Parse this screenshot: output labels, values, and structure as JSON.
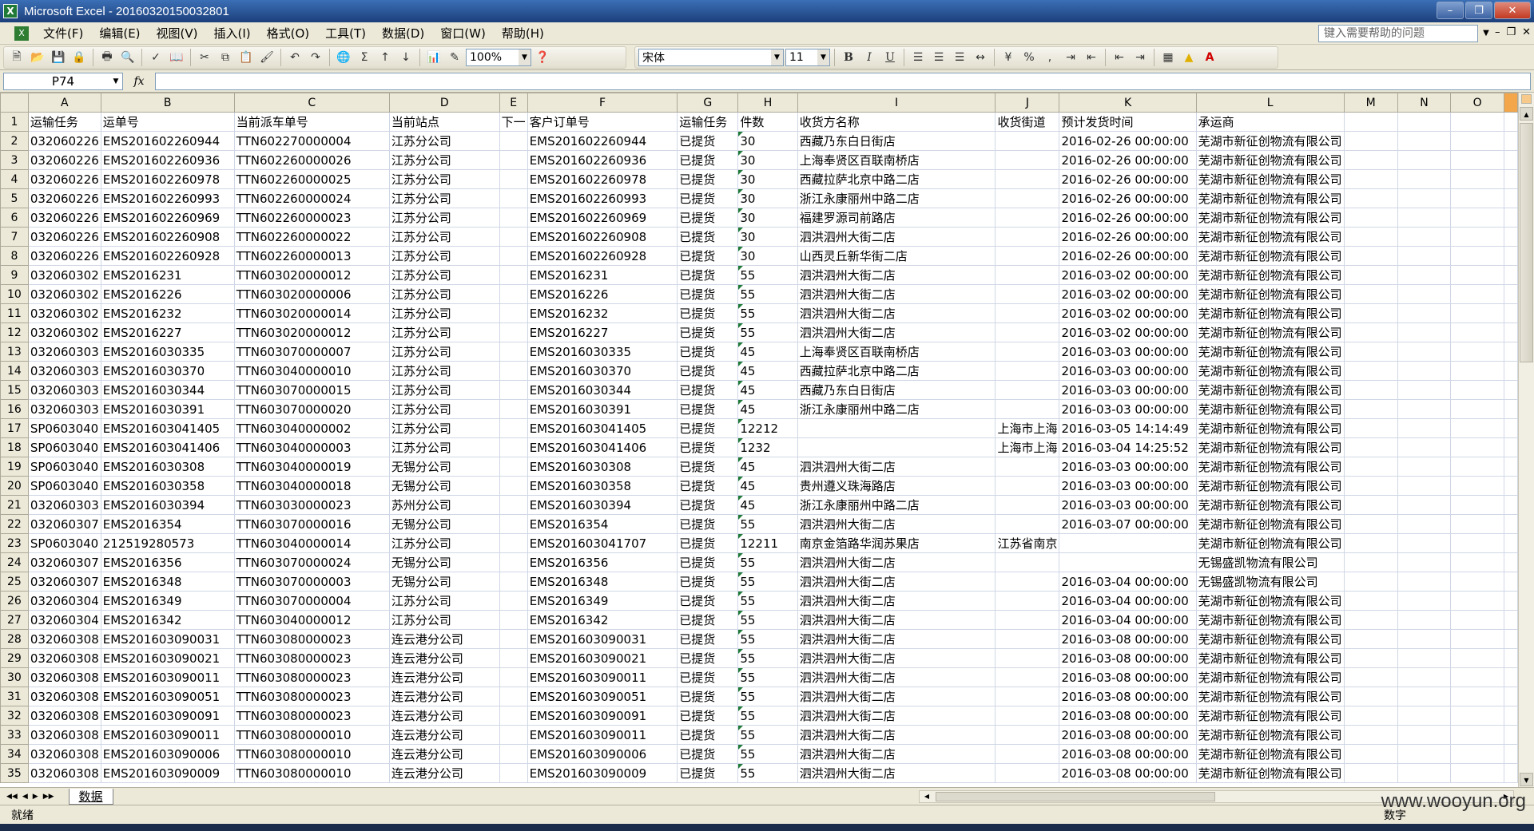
{
  "title": "Microsoft Excel - 20160320150032801",
  "menu": [
    "文件(F)",
    "编辑(E)",
    "视图(V)",
    "插入(I)",
    "格式(O)",
    "工具(T)",
    "数据(D)",
    "窗口(W)",
    "帮助(H)"
  ],
  "help_placeholder": "键入需要帮助的问题",
  "toolbar": {
    "zoom": "100%",
    "font_name": "宋体",
    "font_size": "11",
    "bold": "B",
    "italic": "I",
    "underline": "U",
    "percent": "%"
  },
  "name_box": "P74",
  "fx_label": "fx",
  "columns": [
    "A",
    "B",
    "C",
    "D",
    "E",
    "F",
    "G",
    "H",
    "I",
    "J",
    "K",
    "L",
    "M",
    "N",
    "O"
  ],
  "headers": [
    "运输任务",
    "运单号",
    "当前派车单号",
    "当前站点",
    "下一",
    "客户订单号",
    "运输任务",
    "件数",
    "收货方名称",
    "收货街道",
    "预计发货时间",
    "承运商",
    "",
    "",
    ""
  ],
  "rows": [
    [
      "032060226",
      "EMS201602260944",
      "TTN602270000004",
      "江苏分公司",
      "",
      "EMS201602260944",
      "已提货",
      "30",
      "西藏乃东白日街店",
      "",
      "2016-02-26 00:00:00",
      "芜湖市新征创物流有限公司"
    ],
    [
      "032060226",
      "EMS201602260936",
      "TTN602260000026",
      "江苏分公司",
      "",
      "EMS201602260936",
      "已提货",
      "30",
      "上海奉贤区百联南桥店",
      "",
      "2016-02-26 00:00:00",
      "芜湖市新征创物流有限公司"
    ],
    [
      "032060226",
      "EMS201602260978",
      "TTN602260000025",
      "江苏分公司",
      "",
      "EMS201602260978",
      "已提货",
      "30",
      "西藏拉萨北京中路二店",
      "",
      "2016-02-26 00:00:00",
      "芜湖市新征创物流有限公司"
    ],
    [
      "032060226",
      "EMS201602260993",
      "TTN602260000024",
      "江苏分公司",
      "",
      "EMS201602260993",
      "已提货",
      "30",
      "浙江永康丽州中路二店",
      "",
      "2016-02-26 00:00:00",
      "芜湖市新征创物流有限公司"
    ],
    [
      "032060226",
      "EMS201602260969",
      "TTN602260000023",
      "江苏分公司",
      "",
      "EMS201602260969",
      "已提货",
      "30",
      "福建罗源司前路店",
      "",
      "2016-02-26 00:00:00",
      "芜湖市新征创物流有限公司"
    ],
    [
      "032060226",
      "EMS201602260908",
      "TTN602260000022",
      "江苏分公司",
      "",
      "EMS201602260908",
      "已提货",
      "30",
      "泗洪泗州大街二店",
      "",
      "2016-02-26 00:00:00",
      "芜湖市新征创物流有限公司"
    ],
    [
      "032060226",
      "EMS201602260928",
      "TTN602260000013",
      "江苏分公司",
      "",
      "EMS201602260928",
      "已提货",
      "30",
      "山西灵丘新华街二店",
      "",
      "2016-02-26 00:00:00",
      "芜湖市新征创物流有限公司"
    ],
    [
      "032060302",
      "EMS2016231",
      "TTN603020000012",
      "江苏分公司",
      "",
      "EMS2016231",
      "已提货",
      "55",
      "泗洪泗州大街二店",
      "",
      "2016-03-02 00:00:00",
      "芜湖市新征创物流有限公司"
    ],
    [
      "032060302",
      "EMS2016226",
      "TTN603020000006",
      "江苏分公司",
      "",
      "EMS2016226",
      "已提货",
      "55",
      "泗洪泗州大街二店",
      "",
      "2016-03-02 00:00:00",
      "芜湖市新征创物流有限公司"
    ],
    [
      "032060302",
      "EMS2016232",
      "TTN603020000014",
      "江苏分公司",
      "",
      "EMS2016232",
      "已提货",
      "55",
      "泗洪泗州大街二店",
      "",
      "2016-03-02 00:00:00",
      "芜湖市新征创物流有限公司"
    ],
    [
      "032060302",
      "EMS2016227",
      "TTN603020000012",
      "江苏分公司",
      "",
      "EMS2016227",
      "已提货",
      "55",
      "泗洪泗州大街二店",
      "",
      "2016-03-02 00:00:00",
      "芜湖市新征创物流有限公司"
    ],
    [
      "032060303",
      "EMS2016030335",
      "TTN603070000007",
      "江苏分公司",
      "",
      "EMS2016030335",
      "已提货",
      "45",
      "上海奉贤区百联南桥店",
      "",
      "2016-03-03 00:00:00",
      "芜湖市新征创物流有限公司"
    ],
    [
      "032060303",
      "EMS2016030370",
      "TTN603040000010",
      "江苏分公司",
      "",
      "EMS2016030370",
      "已提货",
      "45",
      "西藏拉萨北京中路二店",
      "",
      "2016-03-03 00:00:00",
      "芜湖市新征创物流有限公司"
    ],
    [
      "032060303",
      "EMS2016030344",
      "TTN603070000015",
      "江苏分公司",
      "",
      "EMS2016030344",
      "已提货",
      "45",
      "西藏乃东白日街店",
      "",
      "2016-03-03 00:00:00",
      "芜湖市新征创物流有限公司"
    ],
    [
      "032060303",
      "EMS2016030391",
      "TTN603070000020",
      "江苏分公司",
      "",
      "EMS2016030391",
      "已提货",
      "45",
      "浙江永康丽州中路二店",
      "",
      "2016-03-03 00:00:00",
      "芜湖市新征创物流有限公司"
    ],
    [
      "SP0603040",
      "EMS201603041405",
      "TTN603040000002",
      "江苏分公司",
      "",
      "EMS201603041405",
      "已提货",
      "12212",
      "",
      "上海市上海",
      "2016-03-05 14:14:49",
      "芜湖市新征创物流有限公司"
    ],
    [
      "SP0603040",
      "EMS201603041406",
      "TTN603040000003",
      "江苏分公司",
      "",
      "EMS201603041406",
      "已提货",
      "1232",
      "",
      "上海市上海",
      "2016-03-04 14:25:52",
      "芜湖市新征创物流有限公司"
    ],
    [
      "SP0603040",
      "EMS2016030308",
      "TTN603040000019",
      "无锡分公司",
      "",
      "EMS2016030308",
      "已提货",
      "45",
      "泗洪泗州大街二店",
      "",
      "2016-03-03 00:00:00",
      "芜湖市新征创物流有限公司"
    ],
    [
      "SP0603040",
      "EMS2016030358",
      "TTN603040000018",
      "无锡分公司",
      "",
      "EMS2016030358",
      "已提货",
      "45",
      "贵州遵义珠海路店",
      "",
      "2016-03-03 00:00:00",
      "芜湖市新征创物流有限公司"
    ],
    [
      "032060303",
      "EMS2016030394",
      "TTN603030000023",
      "苏州分公司",
      "",
      "EMS2016030394",
      "已提货",
      "45",
      "浙江永康丽州中路二店",
      "",
      "2016-03-03 00:00:00",
      "芜湖市新征创物流有限公司"
    ],
    [
      "032060307",
      "EMS2016354",
      "TTN603070000016",
      "无锡分公司",
      "",
      "EMS2016354",
      "已提货",
      "55",
      "泗洪泗州大街二店",
      "",
      "2016-03-07 00:00:00",
      "芜湖市新征创物流有限公司"
    ],
    [
      "SP0603040",
      "212519280573",
      "TTN603040000014",
      "江苏分公司",
      "",
      "EMS201603041707",
      "已提货",
      "12211",
      "南京金箔路华润苏果店",
      "江苏省南京",
      "",
      "芜湖市新征创物流有限公司"
    ],
    [
      "032060307",
      "EMS2016356",
      "TTN603070000024",
      "无锡分公司",
      "",
      "EMS2016356",
      "已提货",
      "55",
      "泗洪泗州大街二店",
      "",
      "",
      "无锡盛凯物流有限公司"
    ],
    [
      "032060307",
      "EMS2016348",
      "TTN603070000003",
      "无锡分公司",
      "",
      "EMS2016348",
      "已提货",
      "55",
      "泗洪泗州大街二店",
      "",
      "2016-03-04 00:00:00",
      "无锡盛凯物流有限公司"
    ],
    [
      "032060304",
      "EMS2016349",
      "TTN603070000004",
      "江苏分公司",
      "",
      "EMS2016349",
      "已提货",
      "55",
      "泗洪泗州大街二店",
      "",
      "2016-03-04 00:00:00",
      "芜湖市新征创物流有限公司"
    ],
    [
      "032060304",
      "EMS2016342",
      "TTN603040000012",
      "江苏分公司",
      "",
      "EMS2016342",
      "已提货",
      "55",
      "泗洪泗州大街二店",
      "",
      "2016-03-04 00:00:00",
      "芜湖市新征创物流有限公司"
    ],
    [
      "032060308",
      "EMS201603090031",
      "TTN603080000023",
      "连云港分公司",
      "",
      "EMS201603090031",
      "已提货",
      "55",
      "泗洪泗州大街二店",
      "",
      "2016-03-08 00:00:00",
      "芜湖市新征创物流有限公司"
    ],
    [
      "032060308",
      "EMS201603090021",
      "TTN603080000023",
      "连云港分公司",
      "",
      "EMS201603090021",
      "已提货",
      "55",
      "泗洪泗州大街二店",
      "",
      "2016-03-08 00:00:00",
      "芜湖市新征创物流有限公司"
    ],
    [
      "032060308",
      "EMS201603090011",
      "TTN603080000023",
      "连云港分公司",
      "",
      "EMS201603090011",
      "已提货",
      "55",
      "泗洪泗州大街二店",
      "",
      "2016-03-08 00:00:00",
      "芜湖市新征创物流有限公司"
    ],
    [
      "032060308",
      "EMS201603090051",
      "TTN603080000023",
      "连云港分公司",
      "",
      "EMS201603090051",
      "已提货",
      "55",
      "泗洪泗州大街二店",
      "",
      "2016-03-08 00:00:00",
      "芜湖市新征创物流有限公司"
    ],
    [
      "032060308",
      "EMS201603090091",
      "TTN603080000023",
      "连云港分公司",
      "",
      "EMS201603090091",
      "已提货",
      "55",
      "泗洪泗州大街二店",
      "",
      "2016-03-08 00:00:00",
      "芜湖市新征创物流有限公司"
    ],
    [
      "032060308",
      "EMS201603090011",
      "TTN603080000010",
      "连云港分公司",
      "",
      "EMS201603090011",
      "已提货",
      "55",
      "泗洪泗州大街二店",
      "",
      "2016-03-08 00:00:00",
      "芜湖市新征创物流有限公司"
    ],
    [
      "032060308",
      "EMS201603090006",
      "TTN603080000010",
      "连云港分公司",
      "",
      "EMS201603090006",
      "已提货",
      "55",
      "泗洪泗州大街二店",
      "",
      "2016-03-08 00:00:00",
      "芜湖市新征创物流有限公司"
    ],
    [
      "032060308",
      "EMS201603090009",
      "TTN603080000010",
      "连云港分公司",
      "",
      "EMS201603090009",
      "已提货",
      "55",
      "泗洪泗州大街二店",
      "",
      "2016-03-08 00:00:00",
      "芜湖市新征创物流有限公司"
    ]
  ],
  "sheet_tab": "数据",
  "status_left": "就绪",
  "status_right": "数字",
  "watermark": "www.wooyun.org"
}
